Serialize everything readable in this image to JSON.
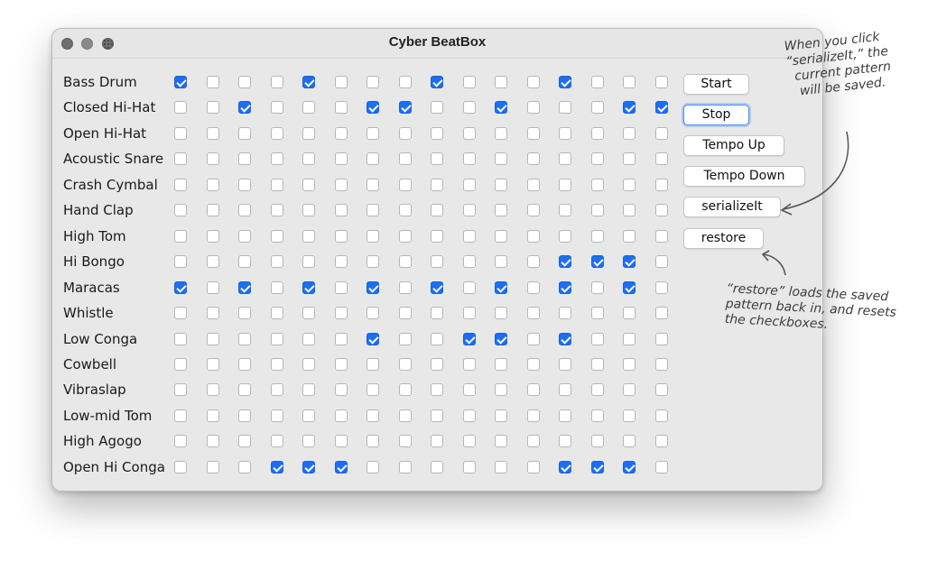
{
  "window": {
    "title": "Cyber BeatBox"
  },
  "instruments": [
    {
      "label": "Bass Drum",
      "steps": [
        1,
        0,
        0,
        0,
        1,
        0,
        0,
        0,
        1,
        0,
        0,
        0,
        1,
        0,
        0,
        0
      ]
    },
    {
      "label": "Closed Hi-Hat",
      "steps": [
        0,
        0,
        1,
        0,
        0,
        0,
        1,
        1,
        0,
        0,
        1,
        0,
        0,
        0,
        1,
        1
      ]
    },
    {
      "label": "Open Hi-Hat",
      "steps": [
        0,
        0,
        0,
        0,
        0,
        0,
        0,
        0,
        0,
        0,
        0,
        0,
        0,
        0,
        0,
        0
      ]
    },
    {
      "label": "Acoustic Snare",
      "steps": [
        0,
        0,
        0,
        0,
        0,
        0,
        0,
        0,
        0,
        0,
        0,
        0,
        0,
        0,
        0,
        0
      ]
    },
    {
      "label": "Crash Cymbal",
      "steps": [
        0,
        0,
        0,
        0,
        0,
        0,
        0,
        0,
        0,
        0,
        0,
        0,
        0,
        0,
        0,
        0
      ]
    },
    {
      "label": "Hand Clap",
      "steps": [
        0,
        0,
        0,
        0,
        0,
        0,
        0,
        0,
        0,
        0,
        0,
        0,
        0,
        0,
        0,
        0
      ]
    },
    {
      "label": "High Tom",
      "steps": [
        0,
        0,
        0,
        0,
        0,
        0,
        0,
        0,
        0,
        0,
        0,
        0,
        0,
        0,
        0,
        0
      ]
    },
    {
      "label": "Hi Bongo",
      "steps": [
        0,
        0,
        0,
        0,
        0,
        0,
        0,
        0,
        0,
        0,
        0,
        0,
        1,
        1,
        1,
        0
      ]
    },
    {
      "label": "Maracas",
      "steps": [
        1,
        0,
        1,
        0,
        1,
        0,
        1,
        0,
        1,
        0,
        1,
        0,
        1,
        0,
        1,
        0
      ]
    },
    {
      "label": "Whistle",
      "steps": [
        0,
        0,
        0,
        0,
        0,
        0,
        0,
        0,
        0,
        0,
        0,
        0,
        0,
        0,
        0,
        0
      ]
    },
    {
      "label": "Low Conga",
      "steps": [
        0,
        0,
        0,
        0,
        0,
        0,
        1,
        0,
        0,
        1,
        1,
        0,
        1,
        0,
        0,
        0
      ]
    },
    {
      "label": "Cowbell",
      "steps": [
        0,
        0,
        0,
        0,
        0,
        0,
        0,
        0,
        0,
        0,
        0,
        0,
        0,
        0,
        0,
        0
      ]
    },
    {
      "label": "Vibraslap",
      "steps": [
        0,
        0,
        0,
        0,
        0,
        0,
        0,
        0,
        0,
        0,
        0,
        0,
        0,
        0,
        0,
        0
      ]
    },
    {
      "label": "Low-mid Tom",
      "steps": [
        0,
        0,
        0,
        0,
        0,
        0,
        0,
        0,
        0,
        0,
        0,
        0,
        0,
        0,
        0,
        0
      ]
    },
    {
      "label": "High Agogo",
      "steps": [
        0,
        0,
        0,
        0,
        0,
        0,
        0,
        0,
        0,
        0,
        0,
        0,
        0,
        0,
        0,
        0
      ]
    },
    {
      "label": "Open Hi Conga",
      "steps": [
        0,
        0,
        0,
        1,
        1,
        1,
        0,
        0,
        0,
        0,
        0,
        0,
        1,
        1,
        1,
        0
      ]
    }
  ],
  "buttons": {
    "start": "Start",
    "stop": "Stop",
    "tempo_up": "Tempo Up",
    "tempo_down": "Tempo Down",
    "serialize": "serializeIt",
    "restore": "restore"
  },
  "annotations": {
    "serialize_note": [
      "When you click",
      "“serializeIt,” the",
      "current pattern",
      "will be saved."
    ],
    "restore_note": [
      "“restore” loads the saved",
      "pattern back in, and resets",
      "the checkboxes."
    ]
  },
  "colors": {
    "checkbox_checked": "#1c6ef3",
    "window_bg": "#e8e8e8",
    "focus_ring": "#4a8ef5"
  }
}
